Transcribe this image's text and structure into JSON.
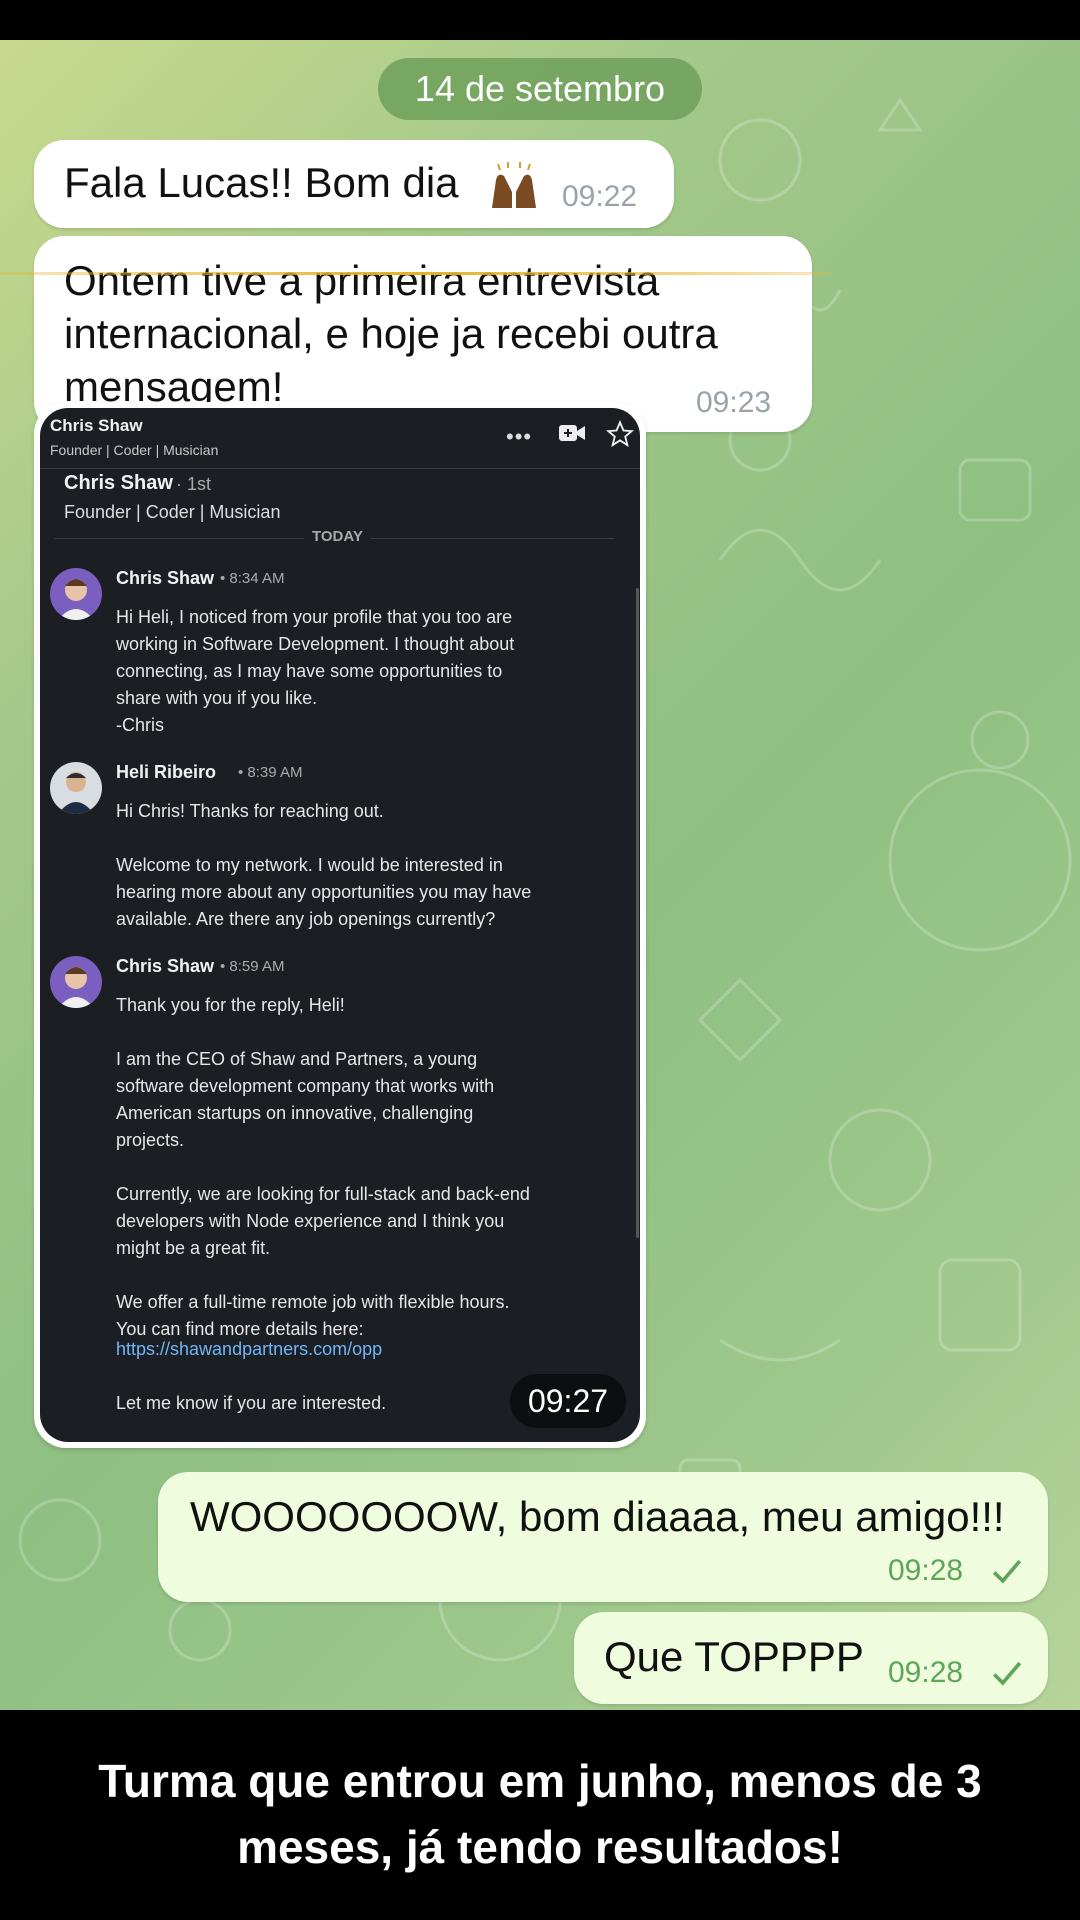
{
  "status_bar": {},
  "chat": {
    "date_divider": "14 de setembro",
    "messages": [
      {
        "text": "Fala Lucas!! Bom dia",
        "emoji": "raising-hands",
        "time": "09:22"
      },
      {
        "lines": [
          "Ontem tive a primeira entrevista",
          "internacional, e hoje ja  recebi outra",
          "mensagem!"
        ],
        "time": "09:23"
      },
      {
        "time": "09:27"
      },
      {
        "text": "WOOOOOOOW, bom diaaaa, meu amigo!!!",
        "time": "09:28"
      },
      {
        "text": "Que TOPPPP",
        "time": "09:28"
      }
    ]
  },
  "linkedin": {
    "header_name": "Chris Shaw",
    "header_headline": "Founder | Coder | Musician",
    "profile_name": "Chris Shaw",
    "profile_degree": "· 1st",
    "profile_headline": "Founder | Coder | Musician",
    "day_divider": "TODAY",
    "messages": [
      {
        "sender": "Chris Shaw",
        "time": "• 8:34 AM",
        "text": "Hi Heli, I noticed from your profile that you too are\nworking in Software Development. I thought about\nconnecting, as I may have some opportunities to\nshare with you if you like.\n-Chris"
      },
      {
        "sender": "Heli Ribeiro",
        "time": "• 8:39 AM",
        "text": "Hi Chris! Thanks for reaching out.\n\nWelcome to my network. I would be interested in\nhearing more about any opportunities you may have\navailable. Are there any job openings currently?"
      },
      {
        "sender": "Chris Shaw",
        "time": "• 8:59 AM",
        "text_a": "Thank you for the reply, Heli!\n\nI am the CEO of Shaw and Partners, a young\nsoftware development company that works with\nAmerican startups on innovative, challenging\nprojects.\n\nCurrently, we are looking for full-stack and back-end\ndevelopers with Node experience and I think you\nmight be a great fit.\n\nWe offer a full-time remote job with flexible hours.\nYou can find more details here:",
        "link": "https://shawandpartners.com/opp",
        "text_b": "Let me know if you are interested."
      }
    ]
  },
  "caption": {
    "line1": "Turma que entrou em junho, menos de 3",
    "line2": "meses, já tendo resultados!"
  },
  "colors": {
    "incoming": "#ffffff",
    "outgoing": "#effdde",
    "check": "#5fa559",
    "link": "#70b5f9"
  }
}
